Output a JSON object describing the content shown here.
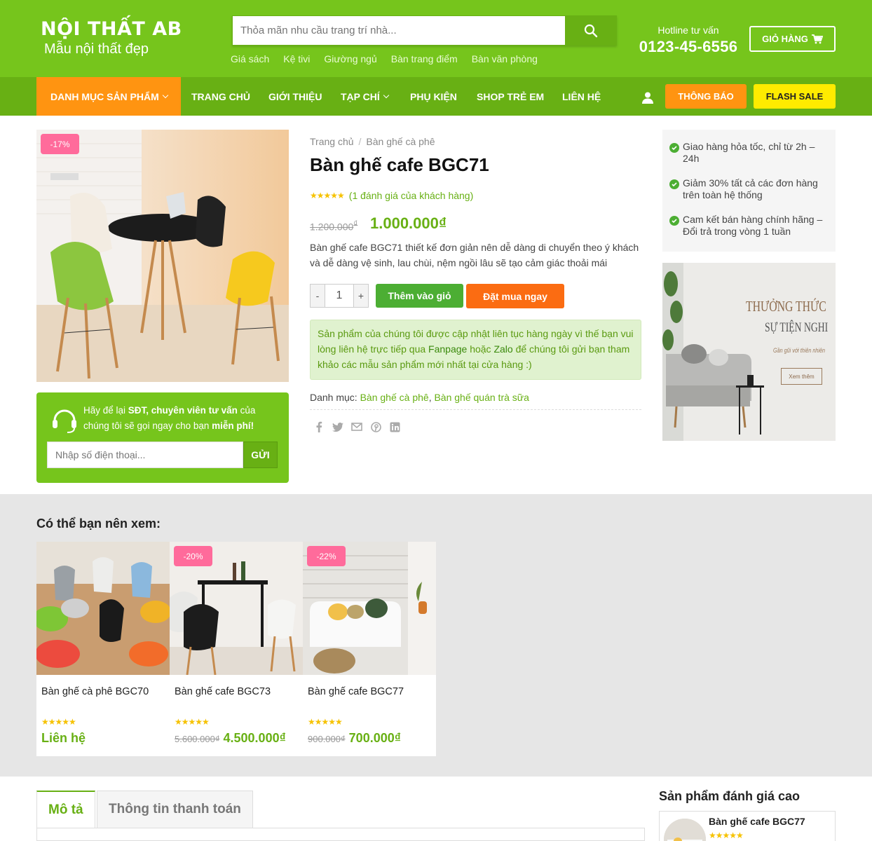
{
  "header": {
    "logo_line1": "NỘI THẤT AB",
    "logo_line2": "Mẫu nội thất đẹp",
    "search_placeholder": "Thỏa mãn nhu cầu trang trí nhà...",
    "quick_links": [
      "Giá sách",
      "Kệ tivi",
      "Giường ngủ",
      "Bàn trang điểm",
      "Bàn văn phòng"
    ],
    "hotline_label": "Hotline tư vấn",
    "hotline_number": "0123-45-6556",
    "cart_label": "GIỎ HÀNG"
  },
  "nav": {
    "category_label": "DANH MỤC SẢN PHẨM",
    "items": [
      "TRANG CHỦ",
      "GIỚI THIỆU",
      "TẠP CHÍ",
      "PHỤ KIỆN",
      "SHOP TRẺ EM",
      "LIÊN HỆ"
    ],
    "notify_label": "THÔNG BÁO",
    "flash_label": "FLASH SALE"
  },
  "product": {
    "badge": "-17%",
    "breadcrumb": [
      "Trang chủ",
      "Bàn ghế cà phê"
    ],
    "title": "Bàn ghế cafe BGC71",
    "stars": "★★★★★",
    "rating_text": "(1 đánh giá của khách hàng)",
    "old_price": "1.200.000",
    "new_price": "1.000.000",
    "currency": "₫",
    "description": "Bàn ghế cafe BGC71 thiết kế đơn giản nên dễ dàng di chuyển theo ý khách và dễ dàng vệ sinh, lau chùi, nệm ngồi lâu sẽ tạo cảm giác thoải mái",
    "qty_minus": "-",
    "qty_value": "1",
    "qty_plus": "+",
    "add_to_cart": "Thêm vào giỏ",
    "buy_now": "Đặt mua ngay",
    "notice_part1": "Sản phẩm của chúng tôi được cập nhật liên tục hàng ngày vì thế bạn vui lòng liên hệ trực tiếp qua ",
    "notice_link1": "Fanpage",
    "notice_part2": " hoặc ",
    "notice_link2": "Zalo",
    "notice_part3": " để chúng tôi gửi bạn tham khảo các mẫu sản phẩm mới nhất tại cửa hàng :)",
    "category_label": "Danh mục: ",
    "category_1": "Bàn ghế cà phê",
    "category_sep": ", ",
    "category_2": "Bàn ghế quán trà sữa"
  },
  "consult": {
    "text_1": "Hãy để lại ",
    "text_bold1": "SĐT, chuyên viên tư vấn",
    "text_2": " của chúng tôi sẽ gọi ngay cho bạn ",
    "text_bold2": "miễn phí!",
    "phone_placeholder": "Nhập số điện thoại...",
    "send_label": "GỬI"
  },
  "perks": [
    "Giao hàng hỏa tốc, chỉ từ 2h – 24h",
    "Giảm 30% tất cả các đơn hàng trên toàn hệ thống",
    "Cam kết bán hàng chính hãng – Đổi trả trong vòng 1 tuần"
  ],
  "banner": {
    "line1": "THƯỞNG THỨC",
    "line2": "SỰ TIỆN NGHI",
    "line3": "Gần gũi với thiên nhiên",
    "button": "Xem thêm"
  },
  "related": {
    "heading": "Có thể bạn nên xem:",
    "items": [
      {
        "name": "Bàn ghế cà phê BGC70",
        "badge": "",
        "old_price": "",
        "price": "Liên hệ"
      },
      {
        "name": "Bàn ghế cafe BGC73",
        "badge": "-20%",
        "old_price": "5.600.000₫",
        "price": "4.500.000₫"
      },
      {
        "name": "Bàn ghế cafe BGC77",
        "badge": "-22%",
        "old_price": "900.000₫",
        "price": "700.000₫"
      }
    ]
  },
  "tabs": [
    "Mô tả",
    "Thông tin thanh toán"
  ],
  "top_rated": {
    "heading": "Sản phẩm đánh giá cao",
    "item_name": "Bàn ghế cafe BGC77"
  },
  "colors": {
    "brand_green": "#76c51c",
    "nav_green": "#68b014",
    "orange": "#ff9411",
    "yellow": "#ffeb00",
    "sale_pink": "#ff6b9b"
  }
}
